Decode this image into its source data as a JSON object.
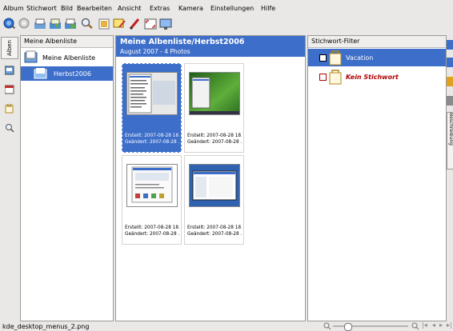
{
  "menubar": [
    {
      "label": "Album"
    },
    {
      "label": "Stichwort"
    },
    {
      "label": "Bild"
    },
    {
      "label": "Bearbeiten"
    },
    {
      "label": "Ansicht"
    },
    {
      "label": "Extras"
    },
    {
      "label": "Kamera"
    },
    {
      "label": "Einstellungen"
    },
    {
      "label": "Hilfe"
    }
  ],
  "toolbar": {
    "icons": [
      "back-icon",
      "forward-icon",
      "up-icon",
      "home-icon",
      "refresh-icon",
      "zoom-icon",
      "image-editor-icon",
      "comment-icon",
      "pencil-icon",
      "fullscreen-icon",
      "slideshow-icon"
    ]
  },
  "left_sidebar": {
    "tab_label": "Alben",
    "icons": [
      "album-view-icon",
      "calendar-icon",
      "tag-icon",
      "search-icon"
    ]
  },
  "album_panel": {
    "header": "Meine Albenliste",
    "root": "Meine Albenliste",
    "child": "Herbst2006"
  },
  "main": {
    "title": "Meine Albenliste/Herbst2006",
    "subtitle": "August 2007 - 4 Photos",
    "thumbnails": [
      {
        "created": "Erstellt: 2007-08-28 18...",
        "modified": "Geändert: 2007-08-28 ...",
        "selected": true
      },
      {
        "created": "Erstellt: 2007-08-28 18...",
        "modified": "Geändert: 2007-08-28 ...",
        "selected": false
      },
      {
        "created": "Erstellt: 2007-08-28 18...",
        "modified": "Geändert: 2007-08-28 ...",
        "selected": false
      },
      {
        "created": "Erstellt: 2007-08-28 18...",
        "modified": "Geändert: 2007-08-28 ...",
        "selected": false
      }
    ]
  },
  "filter_panel": {
    "header": "Stichwort-Filter",
    "items": [
      {
        "label": "Vacation",
        "style": "normal"
      },
      {
        "label": "Kein Stichwort",
        "style": "italic-red"
      }
    ]
  },
  "right_sidebar": {
    "tab_label": "Beschreibung",
    "icons": [
      "properties-icon",
      "metadata-icon",
      "colors-icon",
      "edit-icon"
    ]
  },
  "statusbar": {
    "filename": "kde_desktop_menus_2.png",
    "icons": [
      "zoom-out-icon",
      "zoom-slider",
      "zoom-in-icon",
      "first-icon",
      "prev-icon",
      "next-icon",
      "last-icon"
    ]
  },
  "colors": {
    "accent": "#3d6ec9",
    "background": "#e9e8e6",
    "keyword_red": "#b00000"
  }
}
